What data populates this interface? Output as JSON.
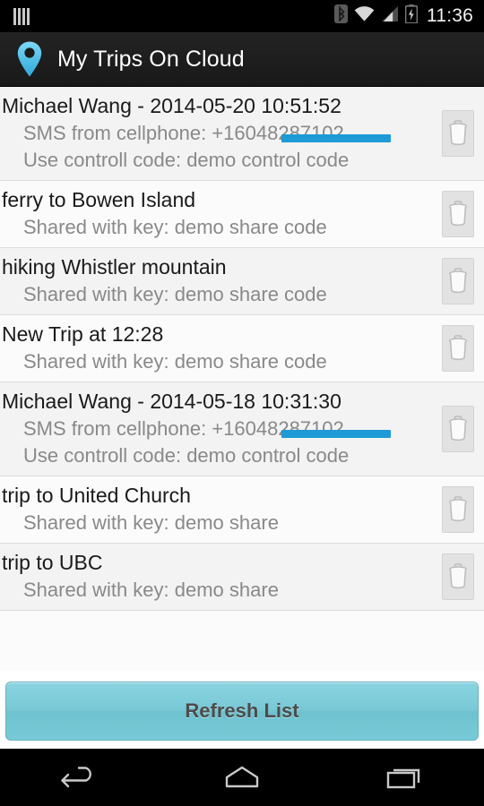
{
  "statusbar": {
    "left_icon": "signal-bars-icon",
    "icons": [
      "bluetooth-icon",
      "wifi-icon",
      "cellular-signal-icon",
      "battery-charging-icon"
    ],
    "clock": "11:36"
  },
  "actionbar": {
    "icon": "map-pin-icon",
    "title": "My Trips On Cloud"
  },
  "list": {
    "delete_icon": "trash-icon",
    "items": [
      {
        "title": "Michael Wang - 2014-05-20 10:51:52",
        "sub1": "SMS from cellphone: +16048287102",
        "sub2": "Use controll code: demo control code",
        "redacted": true
      },
      {
        "title": "ferry to Bowen Island",
        "sub1": "Shared with key: demo share code",
        "sub2": "",
        "redacted": false
      },
      {
        "title": "hiking Whistler mountain",
        "sub1": "Shared with key: demo share code",
        "sub2": "",
        "redacted": false
      },
      {
        "title": "New Trip at 12:28",
        "sub1": "Shared with key: demo share code",
        "sub2": "",
        "redacted": false
      },
      {
        "title": "Michael Wang - 2014-05-18 10:31:30",
        "sub1": "SMS from cellphone: +16048287102",
        "sub2": "Use controll code: demo control code",
        "redacted": true
      },
      {
        "title": "trip to United Church",
        "sub1": "Shared with key: demo share",
        "sub2": "",
        "redacted": false
      },
      {
        "title": "trip to UBC",
        "sub1": "Shared with key: demo share",
        "sub2": "",
        "redacted": false
      }
    ]
  },
  "footer": {
    "refresh_label": "Refresh List"
  },
  "navbar": {
    "back": "back-icon",
    "home": "home-icon",
    "recents": "recents-icon"
  },
  "colors": {
    "accent": "#79c8d6",
    "pin": "#59c6ea",
    "redaction": "#1e9ad6",
    "actionbar_bg": "#1b1b1b",
    "row_bg": "#f3f3f3",
    "row_alt_bg": "#fbfbfb"
  }
}
